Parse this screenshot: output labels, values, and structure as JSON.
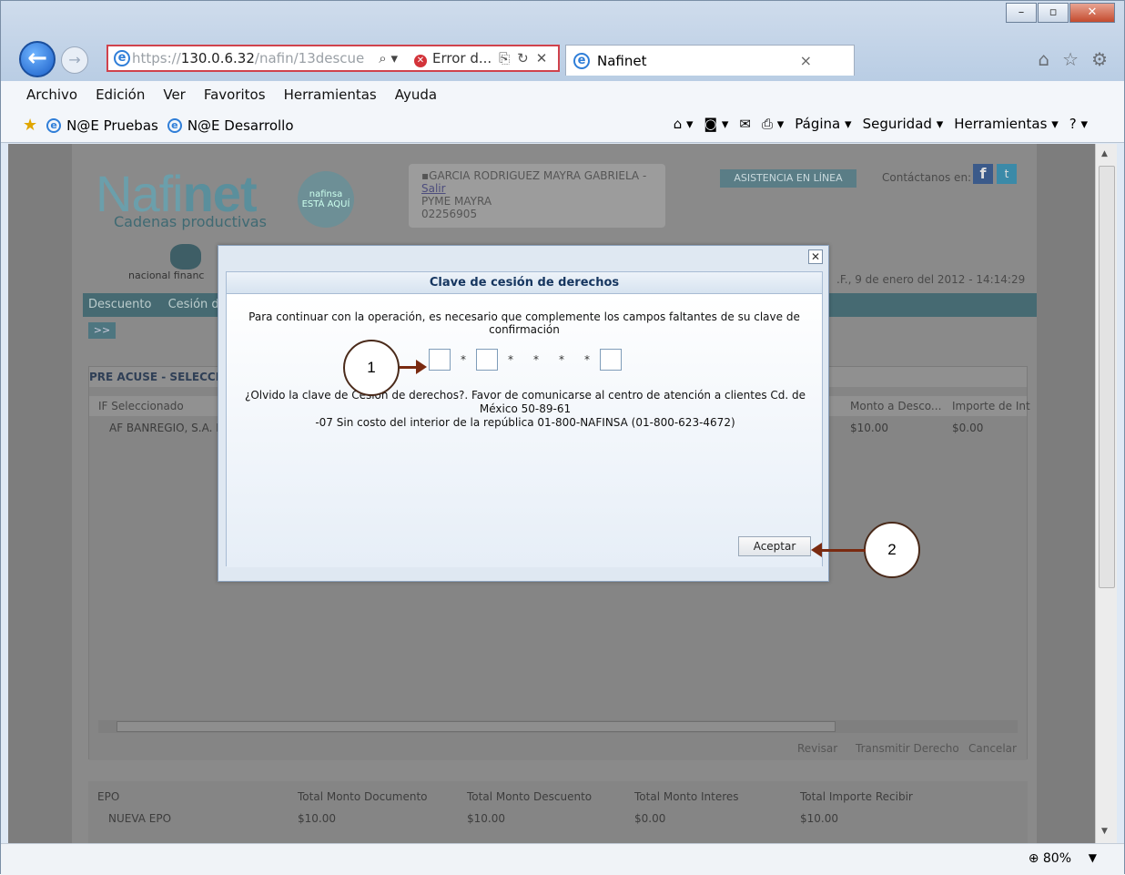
{
  "browser": {
    "address_scheme": "https://",
    "address_host": "130.0.6.32",
    "address_path": "/nafin/13descue",
    "error_tab_label": "Error d...",
    "tab_title": "Nafinet",
    "zoom": "80%"
  },
  "menu": [
    "Archivo",
    "Edición",
    "Ver",
    "Favoritos",
    "Herramientas",
    "Ayuda"
  ],
  "favorites": [
    "N@E Pruebas",
    "N@E Desarrollo"
  ],
  "commandbar": {
    "page": "Página",
    "security": "Seguridad",
    "tools": "Herramientas"
  },
  "site": {
    "logo_light": "Nafi",
    "logo_bold": "net",
    "logo_sub": "Cadenas productivas",
    "badge": "nafinsa ESTÁ AQUÍ",
    "nfin_text": "nacional financ",
    "user_name": "GARCIA RODRIGUEZ MAYRA GABRIELA",
    "logout": "Salir",
    "company": "PYME MAYRA",
    "user_id": "02256905",
    "assist": "ASISTENCIA EN LÍNEA",
    "contact": "Contáctanos en:",
    "datetime": ".F., 9 de enero del 2012 - 14:14:29",
    "nav": [
      "Descuento",
      "Cesión de D"
    ],
    "more": ">>"
  },
  "panel": {
    "title": "PRE ACUSE - SELECCIO",
    "headers": [
      "IF Seleccionado",
      "Monto a Desco...",
      "Importe de Int"
    ],
    "row": [
      "AF BANREGIO, S.A. D",
      "$10.00",
      "$0.00"
    ],
    "actions": [
      "Revisar",
      "Transmitir Derecho",
      "Cancelar"
    ]
  },
  "totals": {
    "headers": [
      "EPO",
      "Total Monto Documento",
      "Total Monto Descuento",
      "Total Monto Interes",
      "Total Importe Recibir"
    ],
    "row": [
      "NUEVA EPO",
      "$10.00",
      "$10.00",
      "$0.00",
      "$10.00"
    ]
  },
  "modal": {
    "title": "Clave de cesión de derechos",
    "message": "Para continuar con la operación, es necesario que complemente los campos faltantes de su clave de confirmación",
    "separators": [
      "*",
      "*",
      "*",
      "*",
      "*"
    ],
    "help_line1": "¿Olvido la clave de Cesión de derechos?. Favor de comunicarse al centro de atención a clientes Cd. de México 50-89-61",
    "help_line2": "-07 Sin costo del interior de la república 01-800-NAFINSA (01-800-623-4672)",
    "accept": "Aceptar"
  },
  "callouts": [
    "1",
    "2"
  ]
}
